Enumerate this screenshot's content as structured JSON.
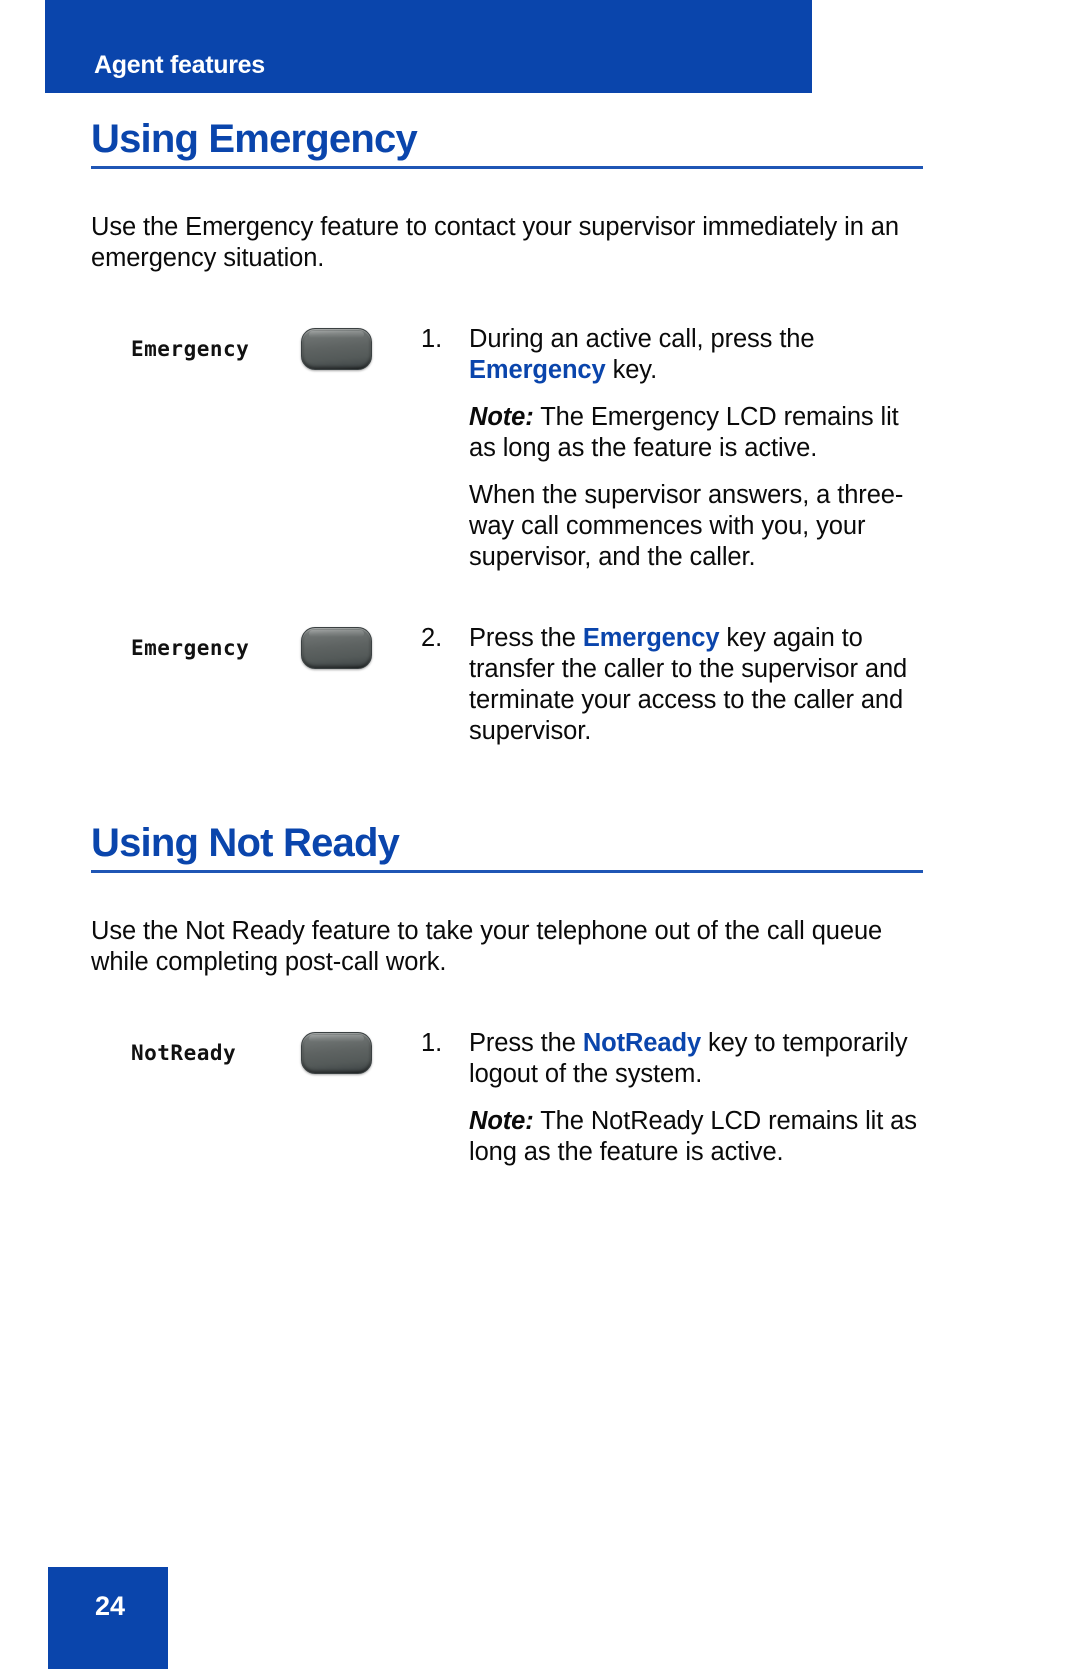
{
  "header": {
    "label": "Agent features",
    "bg_color": "#0A45AC",
    "text_color": "#FFFFFF"
  },
  "accent_color": "#0A45AC",
  "sections": [
    {
      "title": "Using Emergency",
      "intro": "Use the Emergency feature to contact your supervisor immediately in an emergency situation.",
      "steps": [
        {
          "number": "1.",
          "key_label": "Emergency",
          "key_icon": "feature-key-button",
          "line_pre": "During an active call, press the ",
          "line_kw": "Emergency",
          "line_post": " key.",
          "note_label": "Note:",
          "note_text": " The Emergency LCD remains lit as long as the feature is active.",
          "extra_text": "When the supervisor answers, a three-way call commences with you, your supervisor, and the caller."
        },
        {
          "number": "2.",
          "key_label": "Emergency",
          "key_icon": "feature-key-button",
          "line_pre": "Press the ",
          "line_kw": "Emergency",
          "line_post": " key again to transfer the caller to the supervisor and terminate your access to the caller and supervisor.",
          "note_label": "",
          "note_text": "",
          "extra_text": ""
        }
      ]
    },
    {
      "title": "Using Not Ready",
      "intro": "Use the Not Ready feature to take your telephone out of the call queue while completing post-call work.",
      "steps": [
        {
          "number": "1.",
          "key_label": "NotReady",
          "key_icon": "feature-key-button",
          "line_pre": "Press the ",
          "line_kw": "NotReady",
          "line_post": " key to temporarily logout of the system.",
          "note_label": "Note:",
          "note_text": " The NotReady LCD remains lit as long as the feature is active.",
          "extra_text": ""
        }
      ]
    }
  ],
  "footer": {
    "page_number": "24",
    "bg_color": "#0A45AC"
  }
}
